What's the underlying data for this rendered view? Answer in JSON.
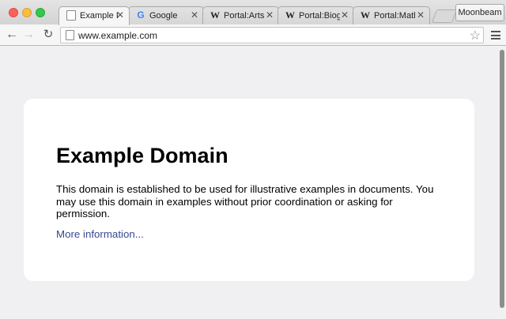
{
  "window": {
    "tabs": [
      {
        "title": "Example Domain",
        "icon": "page-icon",
        "active": true
      },
      {
        "title": "Google",
        "icon": "google-icon",
        "active": false
      },
      {
        "title": "Portal:Arts - W",
        "icon": "wikipedia-icon",
        "active": false
      },
      {
        "title": "Portal:Biograp",
        "icon": "wikipedia-icon",
        "active": false
      },
      {
        "title": "Portal:Mathe",
        "icon": "wikipedia-icon",
        "active": false
      }
    ],
    "close_glyph": "✕",
    "profile_name": "Moonbeam"
  },
  "toolbar": {
    "back_glyph": "←",
    "forward_glyph": "→",
    "reload_glyph": "↻",
    "url": "www.example.com",
    "star_glyph": "☆"
  },
  "page": {
    "heading": "Example Domain",
    "description": "This domain is established to be used for illustrative examples in documents. You may use this domain in examples without prior coordination or asking for permission.",
    "link_text": "More information..."
  },
  "colors": {
    "page_background": "#f0f0f2",
    "link": "#38488f",
    "card": "#ffffff"
  }
}
